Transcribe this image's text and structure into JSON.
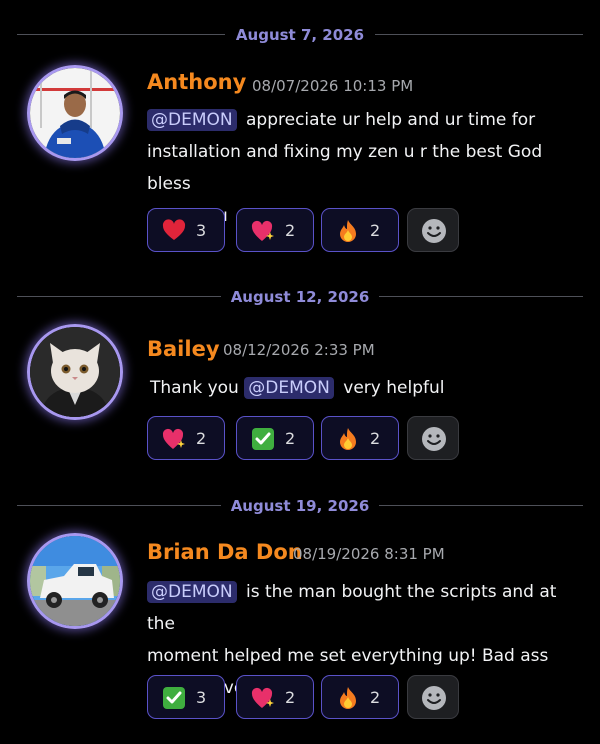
{
  "colors": {
    "background": "#000000",
    "username": "#f5891f",
    "date_divider": "#8f8bd8",
    "mention_bg": "#2c2c6b",
    "reaction_border": "#5a52c8"
  },
  "messages": [
    {
      "date": "August 7, 2026",
      "username": "Anthony",
      "timestamp": "08/07/2026 10:13 PM",
      "mention": "@DEMON",
      "lines": [
        "appreciate ur help and ur time for",
        "installation and fixing my zen u r the best God bless",
        "u thank u"
      ],
      "reactions": [
        {
          "icon": "red-heart-icon",
          "count": "3"
        },
        {
          "icon": "sparkling-heart-icon",
          "count": "2"
        },
        {
          "icon": "fire-icon",
          "count": "2"
        }
      ]
    },
    {
      "date": "August 12, 2026",
      "username": "Bailey",
      "timestamp": "08/12/2026 2:33 PM",
      "text_before": "Thank you",
      "mention": "@DEMON",
      "text_after": "very helpful",
      "reactions": [
        {
          "icon": "sparkling-heart-icon",
          "count": "2"
        },
        {
          "icon": "check-mark-icon",
          "count": "2"
        },
        {
          "icon": "fire-icon",
          "count": "2"
        }
      ]
    },
    {
      "date": "August 19, 2026",
      "username": "Brian Da Don",
      "timestamp": "08/19/2026 8:31 PM",
      "mention": "@DEMON",
      "lines": [
        "is the man bought the scripts and at the",
        "moment helped me set everything up! Bad ass",
        "scripts love it!"
      ],
      "reactions": [
        {
          "icon": "check-mark-icon",
          "count": "3"
        },
        {
          "icon": "sparkling-heart-icon",
          "count": "2"
        },
        {
          "icon": "fire-icon",
          "count": "2"
        }
      ]
    }
  ]
}
